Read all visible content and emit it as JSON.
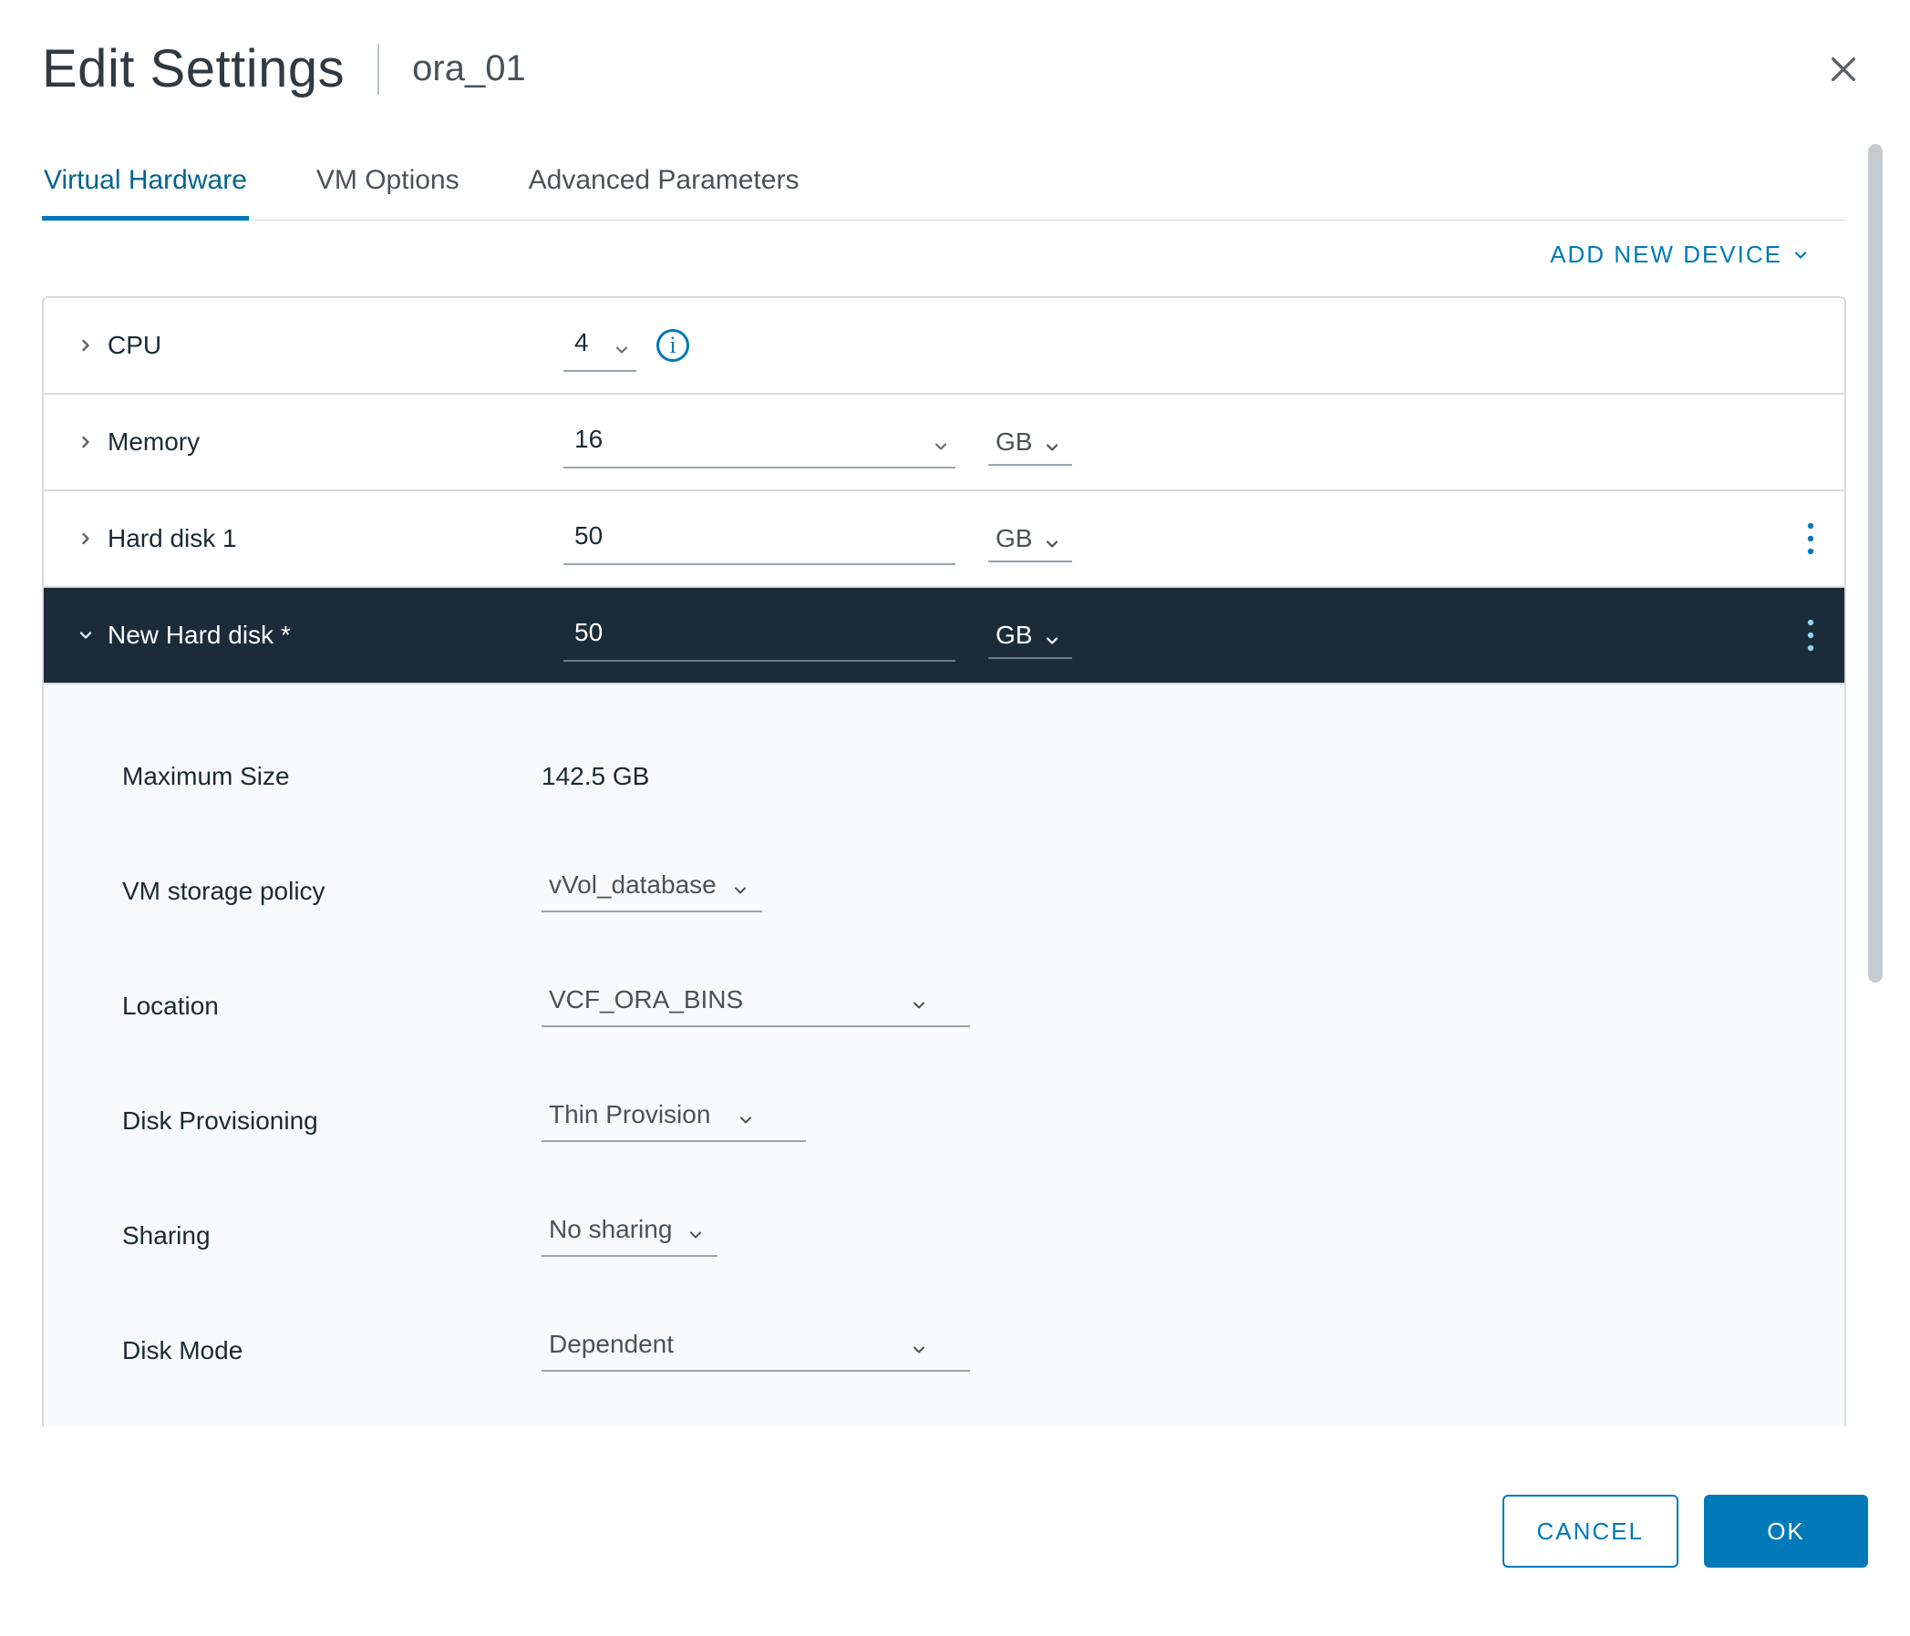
{
  "header": {
    "title": "Edit Settings",
    "context": "ora_01"
  },
  "tabs": [
    {
      "label": "Virtual Hardware",
      "active": true
    },
    {
      "label": "VM Options",
      "active": false
    },
    {
      "label": "Advanced Parameters",
      "active": false
    }
  ],
  "toolbar": {
    "add_new_device": "ADD NEW DEVICE"
  },
  "hardware": {
    "cpu": {
      "label": "CPU",
      "value": "4"
    },
    "memory": {
      "label": "Memory",
      "value": "16",
      "unit": "GB"
    },
    "hdd1": {
      "label": "Hard disk 1",
      "value": "50",
      "unit": "GB"
    },
    "new_hdd": {
      "label": "New Hard disk *",
      "value": "50",
      "unit": "GB",
      "details": {
        "max_size": {
          "label": "Maximum Size",
          "value": "142.5 GB"
        },
        "storage_policy": {
          "label": "VM storage policy",
          "value": "vVol_database"
        },
        "location": {
          "label": "Location",
          "value": "VCF_ORA_BINS"
        },
        "disk_provisioning": {
          "label": "Disk Provisioning",
          "value": "Thin Provision"
        },
        "sharing": {
          "label": "Sharing",
          "value": "No sharing"
        },
        "disk_mode": {
          "label": "Disk Mode",
          "value": "Dependent"
        }
      }
    }
  },
  "footer": {
    "cancel": "CANCEL",
    "ok": "OK"
  }
}
